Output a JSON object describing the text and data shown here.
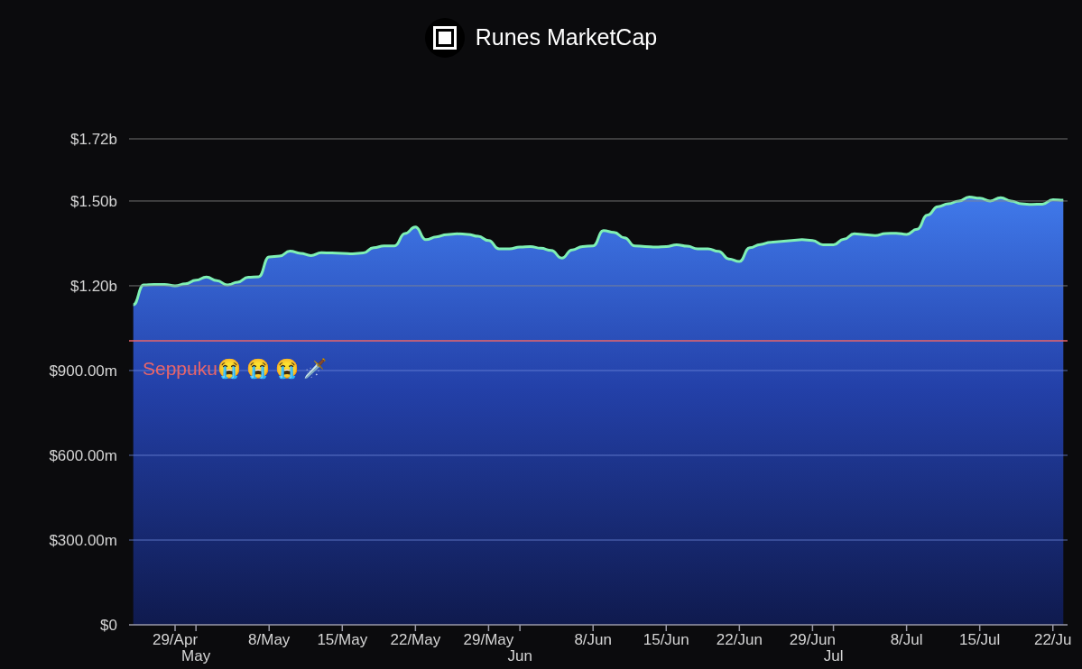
{
  "title": "Runes MarketCap",
  "chart": {
    "chart_data": {
      "type": "area",
      "categories": [
        null,
        null,
        null,
        null,
        "29/Apr",
        null,
        "May",
        null,
        null,
        null,
        null,
        null,
        null,
        "8/May",
        null,
        null,
        null,
        null,
        null,
        null,
        "15/May",
        null,
        null,
        null,
        null,
        null,
        null,
        "22/May",
        null,
        null,
        null,
        null,
        null,
        null,
        "29/May",
        null,
        null,
        "Jun",
        null,
        null,
        null,
        null,
        null,
        null,
        "8/Jun",
        null,
        null,
        null,
        null,
        null,
        null,
        "15/Jun",
        null,
        null,
        null,
        null,
        null,
        null,
        "22/Jun",
        null,
        null,
        null,
        null,
        null,
        null,
        "29/Jun",
        null,
        "Jul",
        null,
        null,
        null,
        null,
        null,
        null,
        "8/Jul",
        null,
        null,
        null,
        null,
        null,
        null,
        "15/Jul",
        null,
        null,
        null,
        null,
        null,
        null,
        "22/Ju",
        null
      ],
      "series": [
        {
          "color": "#7ff0b4",
          "values": [
            1133000000,
            1203000000,
            1205000000,
            1205000000,
            1200000000,
            1207000000,
            1220000000,
            1231000000,
            1218000000,
            1203000000,
            1213000000,
            1230000000,
            1232000000,
            1302000000,
            1305000000,
            1323000000,
            1315000000,
            1307000000,
            1317000000,
            1316000000,
            1315000000,
            1313000000,
            1316000000,
            1335000000,
            1341000000,
            1341000000,
            1385000000,
            1408000000,
            1363000000,
            1373000000,
            1381000000,
            1384000000,
            1382000000,
            1375000000,
            1360000000,
            1331000000,
            1331000000,
            1337000000,
            1339000000,
            1333000000,
            1325000000,
            1298000000,
            1327000000,
            1339000000,
            1341000000,
            1395000000,
            1389000000,
            1370000000,
            1341000000,
            1339000000,
            1337000000,
            1339000000,
            1345000000,
            1340000000,
            1331000000,
            1331000000,
            1322000000,
            1295000000,
            1286000000,
            1335000000,
            1346000000,
            1354000000,
            1357000000,
            1360000000,
            1363000000,
            1360000000,
            1345000000,
            1345000000,
            1365000000,
            1384000000,
            1381000000,
            1378000000,
            1385000000,
            1386000000,
            1382000000,
            1400000000,
            1450000000,
            1480000000,
            1490000000,
            1500000000,
            1514000000,
            1510000000,
            1500000000,
            1512000000,
            1500000000,
            1490000000,
            1488000000,
            1489000000,
            1505000000,
            1503000000
          ]
        }
      ],
      "ylim": [
        0,
        1720000000
      ],
      "yticks": [
        {
          "value": 0,
          "label": "$0"
        },
        {
          "value": 300000000,
          "label": "$300.00m"
        },
        {
          "value": 600000000,
          "label": "$600.00m"
        },
        {
          "value": 900000000,
          "label": "$900.00m"
        },
        {
          "value": 1200000000,
          "label": "$1.20b"
        },
        {
          "value": 1500000000,
          "label": "$1.50b"
        },
        {
          "value": 1720000000,
          "label": "$1.72b"
        }
      ],
      "grid": true,
      "ref_lines": [
        {
          "axis": "y",
          "value": 1005000000,
          "label": "Seppuku😭 😭 😭 🗡️"
        }
      ]
    }
  }
}
